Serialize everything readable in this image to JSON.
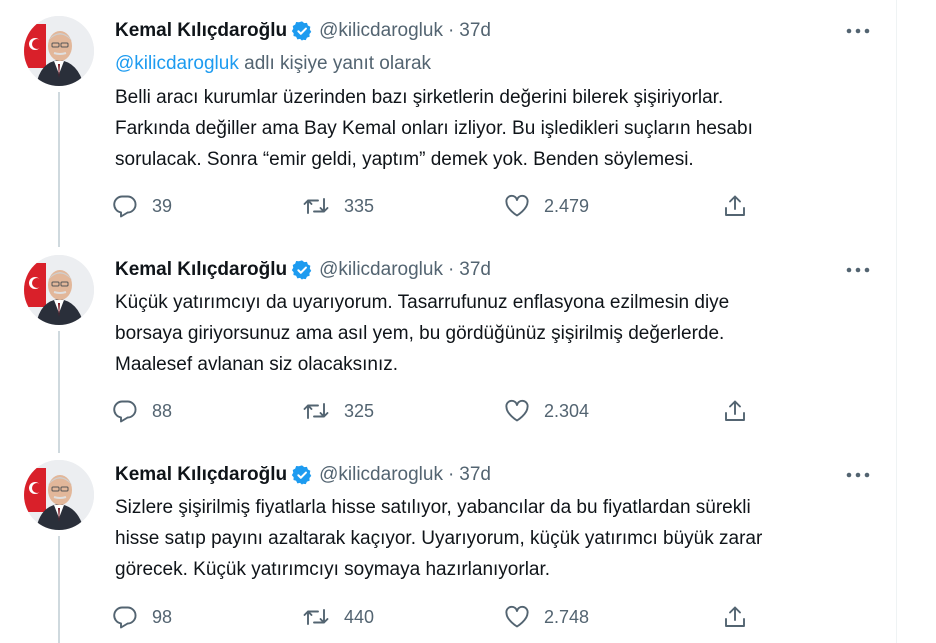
{
  "colors": {
    "accent": "#1d9bf0",
    "text": "#0f1419",
    "muted": "#536471",
    "thread_line": "#cfd9de"
  },
  "tweets": [
    {
      "author_name": "Kemal Kılıçdaroğlu",
      "handle": "@kilicdarogluk",
      "dot": "·",
      "time": "37d",
      "reply_mention": "@kilicdarogluk",
      "reply_suffix": " adlı kişiye yanıt olarak",
      "text": "Belli aracı kurumlar üzerinden bazı şirketlerin değerini bilerek şişiriyorlar.\nFarkında değiller ama Bay Kemal onları izliyor. Bu işledikleri suçların hesabı\nsorulacak. Sonra “emir geldi, yaptım” demek yok. Benden söylemesi.",
      "replies": "39",
      "retweets": "335",
      "likes": "2.479",
      "icons": [
        "avatar",
        "verified-badge-icon",
        "more-icon",
        "reply-icon",
        "retweet-icon",
        "like-icon",
        "share-icon"
      ]
    },
    {
      "author_name": "Kemal Kılıçdaroğlu",
      "handle": "@kilicdarogluk",
      "dot": "·",
      "time": "37d",
      "text": "Küçük yatırımcıyı da uyarıyorum. Tasarrufunuz enflasyona ezilmesin diye\nborsaya giriyorsunuz ama asıl yem, bu gördüğünüz şişirilmiş değerlerde.\nMaalesef avlanan siz olacaksınız.",
      "replies": "88",
      "retweets": "325",
      "likes": "2.304"
    },
    {
      "author_name": "Kemal Kılıçdaroğlu",
      "handle": "@kilicdarogluk",
      "dot": "·",
      "time": "37d",
      "text": "Sizlere şişirilmiş fiyatlarla hisse satılıyor, yabancılar da bu fiyatlardan sürekli\nhisse satıp payını azaltarak kaçıyor. Uyarıyorum, küçük yatırımcı büyük zarar\ngörecek. Küçük yatırımcıyı soymaya hazırlanıyorlar.",
      "replies": "98",
      "retweets": "440",
      "likes": "2.748"
    }
  ]
}
